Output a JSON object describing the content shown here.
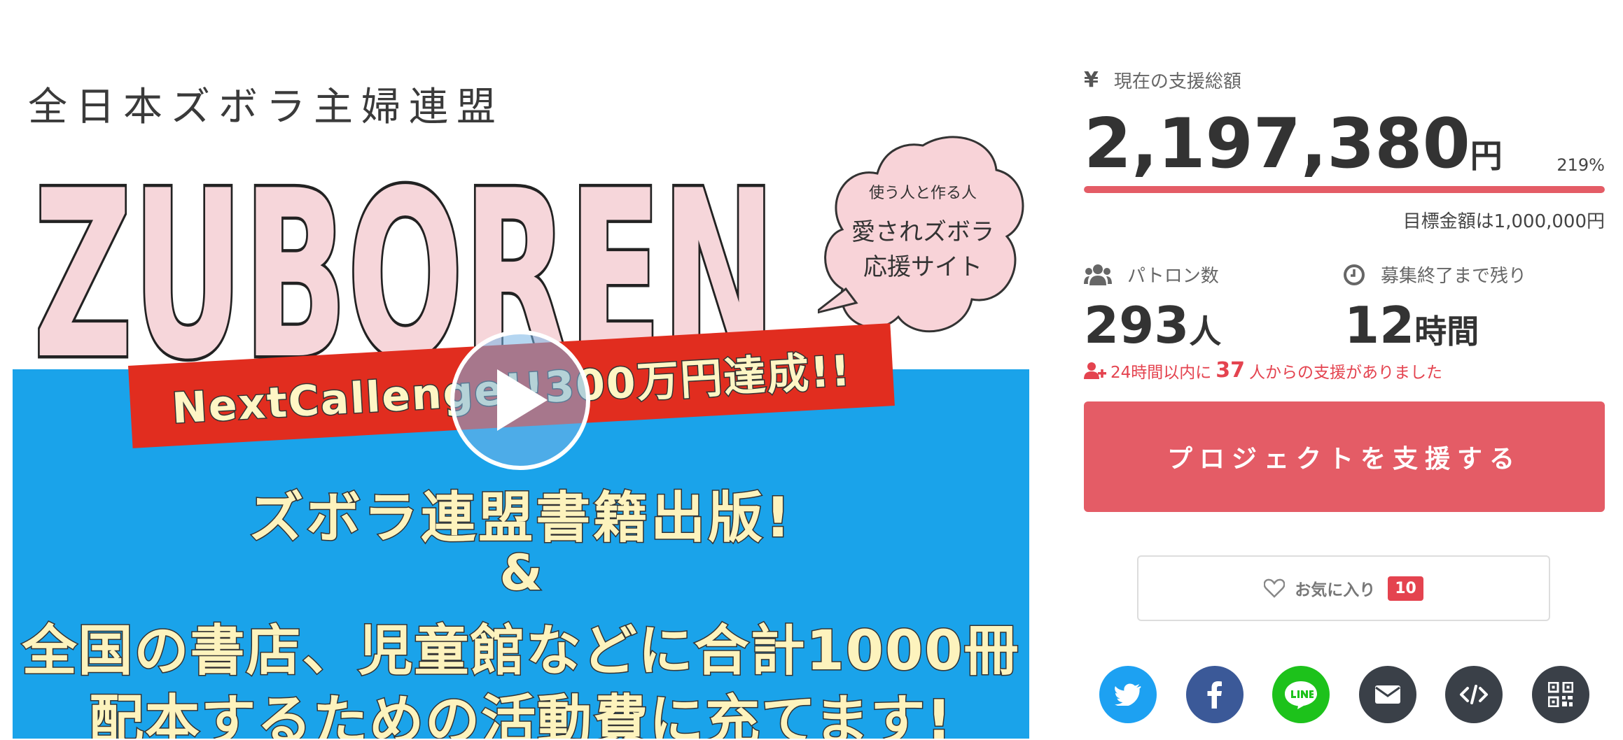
{
  "hero": {
    "subtitle": "全日本ズボラ主婦連盟",
    "logo_text": "ZUBOREN",
    "bubble_line1": "使う人と作る人",
    "bubble_line2": "愛されズボラ",
    "bubble_line3": "応援サイト",
    "banner": "NextCallenge!!300万円達成!!",
    "line1": "ズボラ連盟書籍出版!",
    "line2": "&",
    "line3": "全国の書店、児童館などに合計1000冊",
    "line4": "配本するための活動費に充てます!"
  },
  "funding": {
    "currency_icon": "¥",
    "label": "現在の支援総額",
    "amount": "2,197,380",
    "amount_unit": "円",
    "percent": "219%",
    "progress_fraction": 1.0,
    "goal": "目標金額は1,000,000円"
  },
  "patrons": {
    "label": "パトロン数",
    "value": "293",
    "unit": "人"
  },
  "remaining": {
    "label": "募集終了まで残り",
    "value": "12",
    "unit": "時間"
  },
  "recent": {
    "prefix": "24時間以内に",
    "count": "37",
    "suffix": "人からの支援がありました"
  },
  "support_button": "プロジェクトを支援する",
  "favorite": {
    "label": "お気に入り",
    "count": "10"
  },
  "share": [
    {
      "name": "twitter-icon",
      "color": "#1da1f2"
    },
    {
      "name": "facebook-icon",
      "color": "#3b5998"
    },
    {
      "name": "line-icon",
      "color": "#1dc21b"
    },
    {
      "name": "email-icon",
      "color": "#3a4048"
    },
    {
      "name": "embed-code-icon",
      "color": "#3a4048"
    },
    {
      "name": "qr-code-icon",
      "color": "#3a4048"
    }
  ],
  "colors": {
    "accent": "#e45c66",
    "alert": "#e4434f",
    "hero_blue": "#1aa3ea",
    "banner_red": "#e12d1f"
  }
}
